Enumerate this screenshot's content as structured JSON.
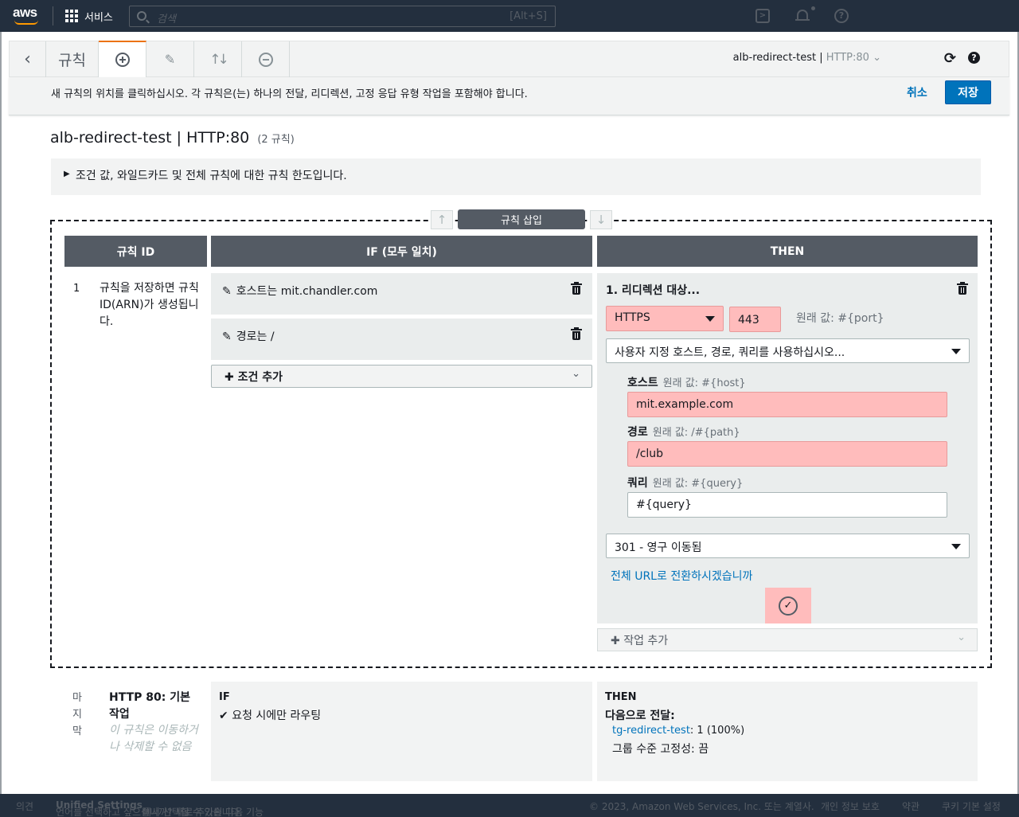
{
  "topnav": {
    "logo": "aws",
    "services_label": "서비스",
    "search_placeholder": "검색",
    "search_shortcut": "[Alt+S]",
    "icons": [
      "cloudshell-icon",
      "bell-icon",
      "help-icon"
    ]
  },
  "toolbar": {
    "title": "규칙",
    "listener_name": "alb-redirect-test",
    "listener_sep": "|",
    "listener_port": "HTTP:80",
    "icons": [
      "back-icon",
      "add-icon",
      "edit-icon",
      "reorder-icon",
      "delete-icon",
      "refresh-icon",
      "help-icon"
    ]
  },
  "infobar": {
    "message": "새 규칙의 위치를 클릭하십시오. 각 규칙은(는) 하나의 전달, 리디렉션, 고정 응답 유형 작업을 포함해야 합니다.",
    "cancel": "취소",
    "save": "저장"
  },
  "page": {
    "title": "alb-redirect-test | HTTP:80",
    "count": "(2 규칙)",
    "limits": "조건 값, 와일드카드 및 전체 규칙에 대한 규칙 한도입니다."
  },
  "editor": {
    "insert_rule": "규칙 삽입",
    "col_id": "규칙 ID",
    "col_if": "IF (모두 일치)",
    "col_then": "THEN",
    "rule_num": "1",
    "rule_note": "규칙을 저장하면 규칙 ID(ARN)가 생성됩니다.",
    "conditions": [
      {
        "label": "호스트는 mit.chandler.com"
      },
      {
        "label": "경로는 /"
      }
    ],
    "add_condition": "조건 추가",
    "action": {
      "title": "1. 리디렉션 대상...",
      "protocol": "HTTPS",
      "port": "443",
      "port_original": "원래 값: #{port}",
      "dest_mode": "사용자 지정 호스트, 경로, 쿼리를 사용하십시오...",
      "host_label": "호스트",
      "host_original": "원래 값: #{host}",
      "host_value": "mit.example.com",
      "path_label": "경로",
      "path_original": "원래 값: /#{path}",
      "path_value": "/club",
      "query_label": "쿼리",
      "query_original": "원래 값: #{query}",
      "query_value": "#{query}",
      "status_code": "301 - 영구 이동됨",
      "full_url_link": "전체 URL로 전환하시겠습니까"
    },
    "add_action": "작업 추가"
  },
  "default_rule": {
    "last": "마지막",
    "title": "HTTP 80: 기본 작업",
    "note": "이 규칙은 이동하거나 삭제할 수 없음",
    "if_label": "IF",
    "if_value": "요청 시에만 라우팅",
    "then_label": "THEN",
    "forward_label": "다음으로 전달:",
    "target_group": "tg-redirect-test",
    "target_weight": ": 1 (100%)",
    "stickiness": "그룹 수준 고정성: 끔"
  },
  "footer": {
    "feedback": "의견",
    "language_prompt": "언어를 선택하고 싶으십니까? 새로 추가된 다음 기능",
    "unified_settings": "Unified Settings",
    "language_suffix": "에서 선택할 수 있습니다.",
    "copyright": "© 2023, Amazon Web Services, Inc. 또는 계열사.",
    "privacy": "개인 정보 보호",
    "terms": "약관",
    "cookies": "쿠키 기본 설정"
  },
  "colors": {
    "nav_bg": "#232f3e",
    "primary": "#0073bb",
    "accent": "#ec7211",
    "highlight": "#ffbcbc",
    "header_bg": "#545b64"
  }
}
